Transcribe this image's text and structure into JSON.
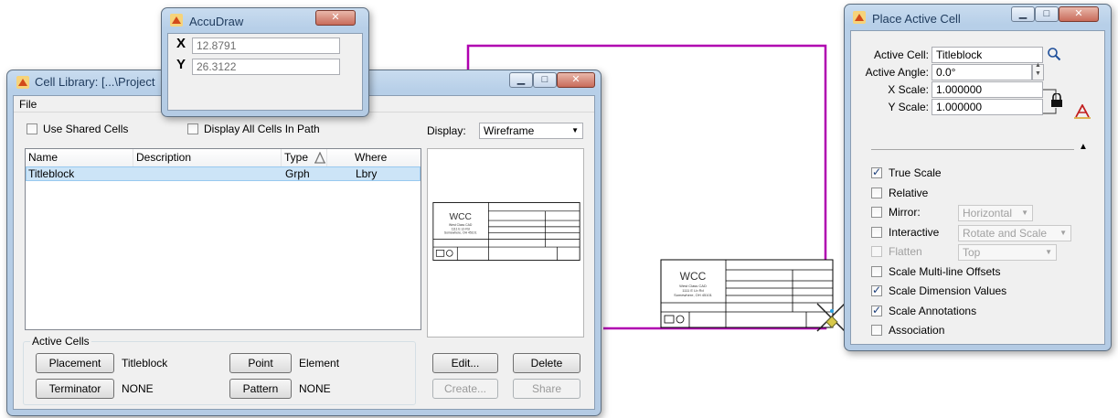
{
  "accudraw": {
    "title": "AccuDraw",
    "x_label": "X",
    "x_value": "12.8791",
    "y_label": "Y",
    "y_value": "26.3122"
  },
  "cell_library": {
    "title": "Cell Library: [...\\Project",
    "menu": {
      "file": "File"
    },
    "use_shared_cells": {
      "label": "Use Shared Cells",
      "checked": false
    },
    "display_all_cells": {
      "label": "Display All Cells In Path",
      "checked": false
    },
    "display": {
      "label": "Display:",
      "value": "Wireframe"
    },
    "columns": [
      "Name",
      "Description",
      "Type",
      "Where"
    ],
    "rows": [
      {
        "name": "Titleblock",
        "description": "",
        "type": "Grph",
        "where": "Lbry"
      }
    ],
    "active_cells": {
      "group_label": "Active Cells",
      "placement_button": "Placement",
      "placement_value": "Titleblock",
      "terminator_button": "Terminator",
      "terminator_value": "NONE",
      "point_button": "Point",
      "point_value": "Element",
      "pattern_button": "Pattern",
      "pattern_value": "NONE"
    },
    "buttons": {
      "edit": "Edit...",
      "delete": "Delete",
      "create": "Create...",
      "share": "Share"
    }
  },
  "titleblock_preview": {
    "logo": "WCC",
    "line1": "West Class CAD",
    "line2": "1111 E Lb Rd",
    "line3": "Somewhere, OH 45101"
  },
  "place_active_cell": {
    "title": "Place Active Cell",
    "active_cell_label": "Active Cell:",
    "active_cell_value": "Titleblock",
    "active_angle_label": "Active Angle:",
    "active_angle_value": "0.0°",
    "x_scale_label": "X Scale:",
    "x_scale_value": "1.000000",
    "y_scale_label": "Y Scale:",
    "y_scale_value": "1.000000",
    "options": [
      {
        "label": "True Scale",
        "checked": true,
        "enabled": true
      },
      {
        "label": "Relative",
        "checked": false,
        "enabled": true
      },
      {
        "label": "Mirror:",
        "checked": false,
        "enabled": true,
        "combo": "Horizontal"
      },
      {
        "label": "Interactive",
        "checked": false,
        "enabled": true,
        "combo": "Rotate and Scale"
      },
      {
        "label": "Flatten",
        "checked": false,
        "enabled": false,
        "combo": "Top"
      },
      {
        "label": "Scale Multi-line Offsets",
        "checked": false,
        "enabled": true
      },
      {
        "label": "Scale Dimension Values",
        "checked": true,
        "enabled": true
      },
      {
        "label": "Scale Annotations",
        "checked": true,
        "enabled": true
      },
      {
        "label": "Association",
        "checked": false,
        "enabled": true
      }
    ]
  },
  "colors": {
    "cell_outline": "#b000b0",
    "selection": "#cce4f7",
    "title_bar": "#b9d1ea",
    "close_button": "#c86b5a"
  }
}
